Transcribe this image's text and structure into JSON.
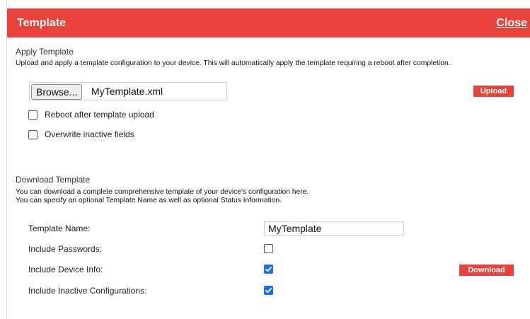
{
  "dialog": {
    "title": "Template",
    "close_label": "Close"
  },
  "apply": {
    "heading": "Apply Template",
    "description": "Upload and apply a template configuration to your device. This will automatically apply the template requiring a reboot after completion.",
    "browse_label": "Browse...",
    "file_name": "MyTemplate.xml",
    "upload_label": "Upload",
    "options": [
      {
        "label": "Reboot after template upload",
        "checked": false
      },
      {
        "label": "Overwrite inactive fields",
        "checked": false
      }
    ]
  },
  "download": {
    "heading": "Download Template",
    "description_line1": "You can download a complete comprehensive template of your device's configuration here.",
    "description_line2": "You can specify an optional Template Name as well as optional Status Information.",
    "template_name_label": "Template Name:",
    "template_name_value": "MyTemplate",
    "fields": [
      {
        "label": "Include Passwords:",
        "checked": false
      },
      {
        "label": "Include Device Info:",
        "checked": true
      },
      {
        "label": "Include Inactive Configurations:",
        "checked": true
      }
    ],
    "download_label": "Download"
  },
  "colors": {
    "accent_red": "#e8423a",
    "checkbox_blue": "#1f6fe0"
  }
}
